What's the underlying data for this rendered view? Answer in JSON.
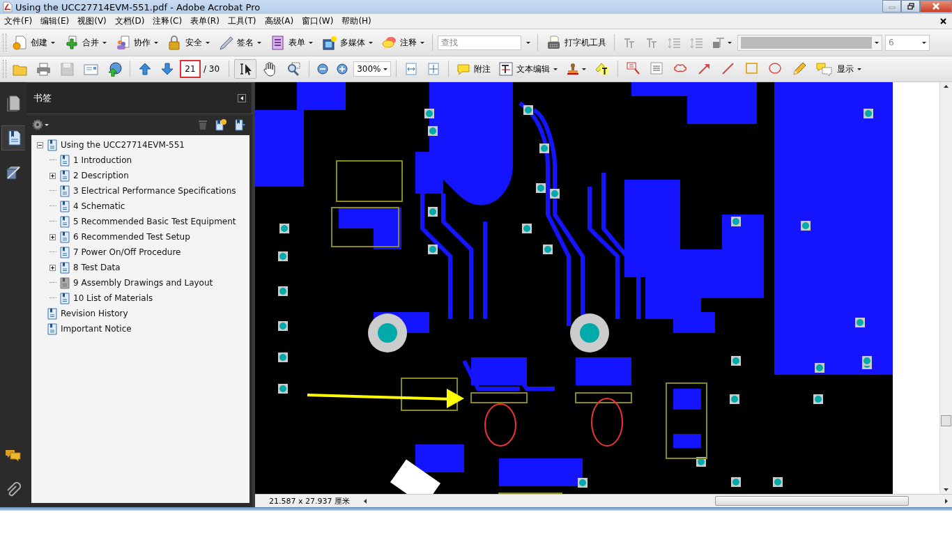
{
  "window": {
    "title": "Using the UCC27714EVM-551.pdf - Adobe Acrobat Pro"
  },
  "menu": [
    "文件(F)",
    "编辑(E)",
    "视图(V)",
    "文档(D)",
    "注释(C)",
    "表单(R)",
    "工具(T)",
    "高级(A)",
    "窗口(W)",
    "帮助(H)"
  ],
  "toolbar": {
    "buttons": [
      {
        "label": "创建",
        "dropdown": true
      },
      {
        "label": "合并",
        "dropdown": true
      },
      {
        "label": "协作",
        "dropdown": true
      },
      {
        "label": "安全",
        "dropdown": true
      },
      {
        "label": "签名",
        "dropdown": true
      },
      {
        "label": "表单",
        "dropdown": true
      },
      {
        "label": "多媒体",
        "dropdown": true
      },
      {
        "label": "注释",
        "dropdown": true
      }
    ],
    "search": {
      "placeholder": "查找"
    },
    "typewriter": {
      "label": "打字机工具"
    },
    "font_size": "6"
  },
  "nav_toolbar": {
    "page": "21",
    "page_count": "/ 30",
    "zoom": "300%",
    "note": {
      "label": "附注"
    },
    "text_edit": {
      "label": "文本编辑",
      "dropdown": true
    },
    "show": {
      "label": "显示",
      "dropdown": true
    }
  },
  "sidebar": {
    "title": "书签",
    "bookmarks": [
      {
        "label": "Using the UCC27714EVM-551",
        "expandable": true,
        "expanded": true,
        "dimmed": false,
        "children": [
          {
            "label": "1  Introduction",
            "expandable": false,
            "dimmed": false
          },
          {
            "label": "2  Description",
            "expandable": true,
            "expanded": false,
            "dimmed": false
          },
          {
            "label": "3  Electrical Performance Specifications",
            "expandable": false,
            "dimmed": false
          },
          {
            "label": "4  Schematic",
            "expandable": false,
            "dimmed": false
          },
          {
            "label": "5  Recommended Basic Test Equipment",
            "expandable": false,
            "dimmed": false
          },
          {
            "label": "6  Recommended Test Setup",
            "expandable": true,
            "expanded": false,
            "dimmed": false
          },
          {
            "label": "7  Power On/Off Procedure",
            "expandable": false,
            "dimmed": false
          },
          {
            "label": "8  Test Data",
            "expandable": true,
            "expanded": false,
            "dimmed": false
          },
          {
            "label": "9   Assembly Drawings and Layout",
            "expandable": false,
            "dimmed": true
          },
          {
            "label": "10  List of Materials",
            "expandable": false,
            "dimmed": false
          }
        ]
      },
      {
        "label": "Revision History",
        "expandable": false,
        "dimmed": false
      },
      {
        "label": "Important Notice",
        "expandable": false,
        "dimmed": false
      }
    ]
  },
  "status_bar": {
    "page_size": "21.587 x 27.937 厘米"
  }
}
